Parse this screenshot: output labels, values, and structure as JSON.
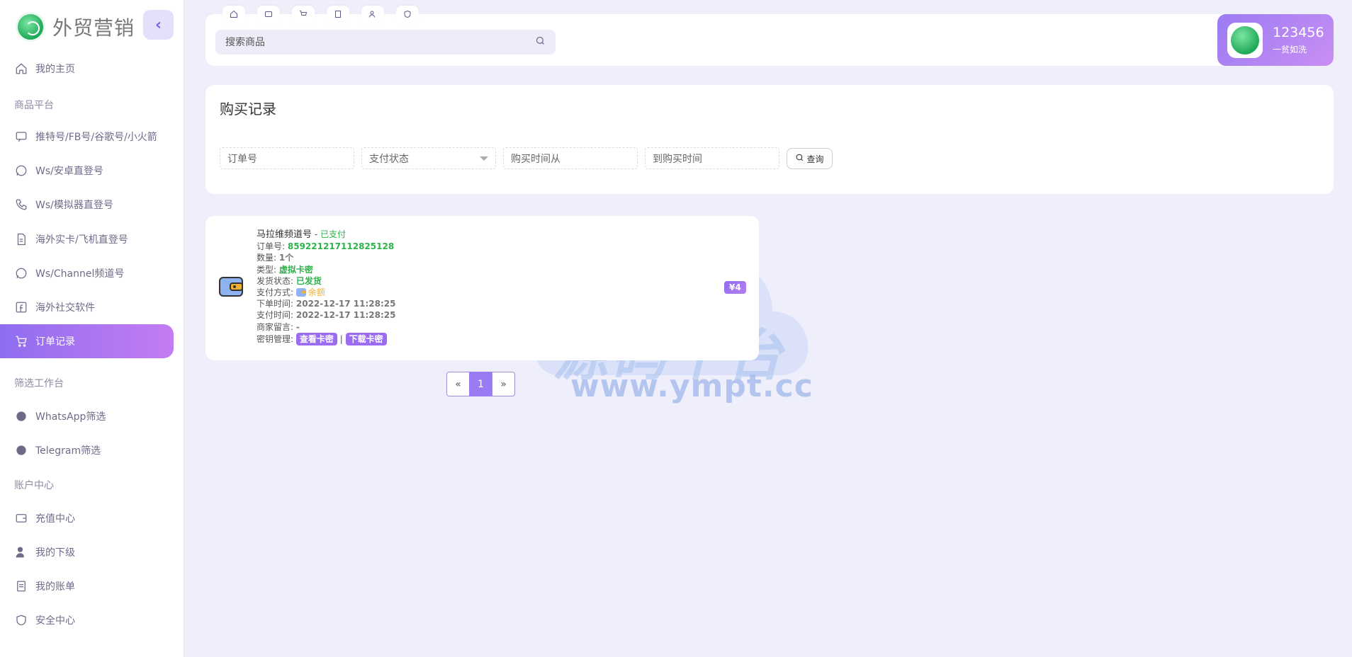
{
  "brand": {
    "title": "外贸营销"
  },
  "sidebar": {
    "items": [
      {
        "label": "我的主页",
        "icon": "home-icon"
      },
      {
        "section": "商品平台"
      },
      {
        "label": "推特号/FB号/谷歌号/小火箭",
        "icon": "message-icon"
      },
      {
        "label": "Ws/安卓直登号",
        "icon": "whatsapp-icon"
      },
      {
        "label": "Ws/模拟器直登号",
        "icon": "phone-icon"
      },
      {
        "label": "海外实卡/飞机直登号",
        "icon": "document-icon"
      },
      {
        "label": "Ws/Channel频道号",
        "icon": "whatsapp-icon"
      },
      {
        "label": "海外社交软件",
        "icon": "facebook-icon"
      },
      {
        "label": "订单记录",
        "icon": "cart-icon",
        "active": true
      },
      {
        "section": "筛选工作台"
      },
      {
        "label": "WhatsApp筛选",
        "icon": "whatsapp-icon"
      },
      {
        "label": "Telegram筛选",
        "icon": "telegram-icon"
      },
      {
        "section": "账户中心"
      },
      {
        "label": "充值中心",
        "icon": "wallet-icon"
      },
      {
        "label": "我的下级",
        "icon": "user-star-icon"
      },
      {
        "label": "我的账单",
        "icon": "bill-icon"
      },
      {
        "label": "安全中心",
        "icon": "shield-icon"
      }
    ]
  },
  "topbar": {
    "quick_tabs": [
      "home-icon",
      "wallet-icon",
      "cart-icon",
      "document-icon",
      "user-star-icon",
      "shield-icon"
    ],
    "search_placeholder": "搜索商品"
  },
  "user": {
    "name": "123456",
    "motto": "一贫如洗"
  },
  "records": {
    "title": "购买记录",
    "filters": {
      "order_no": "订单号",
      "pay_status": "支付状态",
      "time_from": "购买时间从",
      "time_to": "到购买时间"
    },
    "query_label": "查询"
  },
  "order": {
    "product": "马拉维频道号",
    "separator": " - ",
    "status": "已支付",
    "order_no_label": "订单号:",
    "order_no": "859221217112825128",
    "qty_label": "数量:",
    "qty": "1个",
    "type_label": "类型:",
    "type": "虚拟卡密",
    "ship_label": "发货状态:",
    "ship": "已发货",
    "pay_method_label": "支付方式:",
    "pay_method": "余额",
    "order_time_label": "下单时间:",
    "order_time": "2022-12-17 11:28:25",
    "pay_time_label": "支付时间:",
    "pay_time": "2022-12-17 11:28:25",
    "note_label": "商家留言:",
    "note": "-",
    "key_label": "密钥管理:",
    "view_key": "查看卡密",
    "pipe": "|",
    "download_key": "下载卡密",
    "price": "¥4"
  },
  "pagination": {
    "prev": "«",
    "current": "1",
    "next": "»"
  },
  "watermark": {
    "title": "源码平台",
    "url": "www.ympt.cc"
  }
}
